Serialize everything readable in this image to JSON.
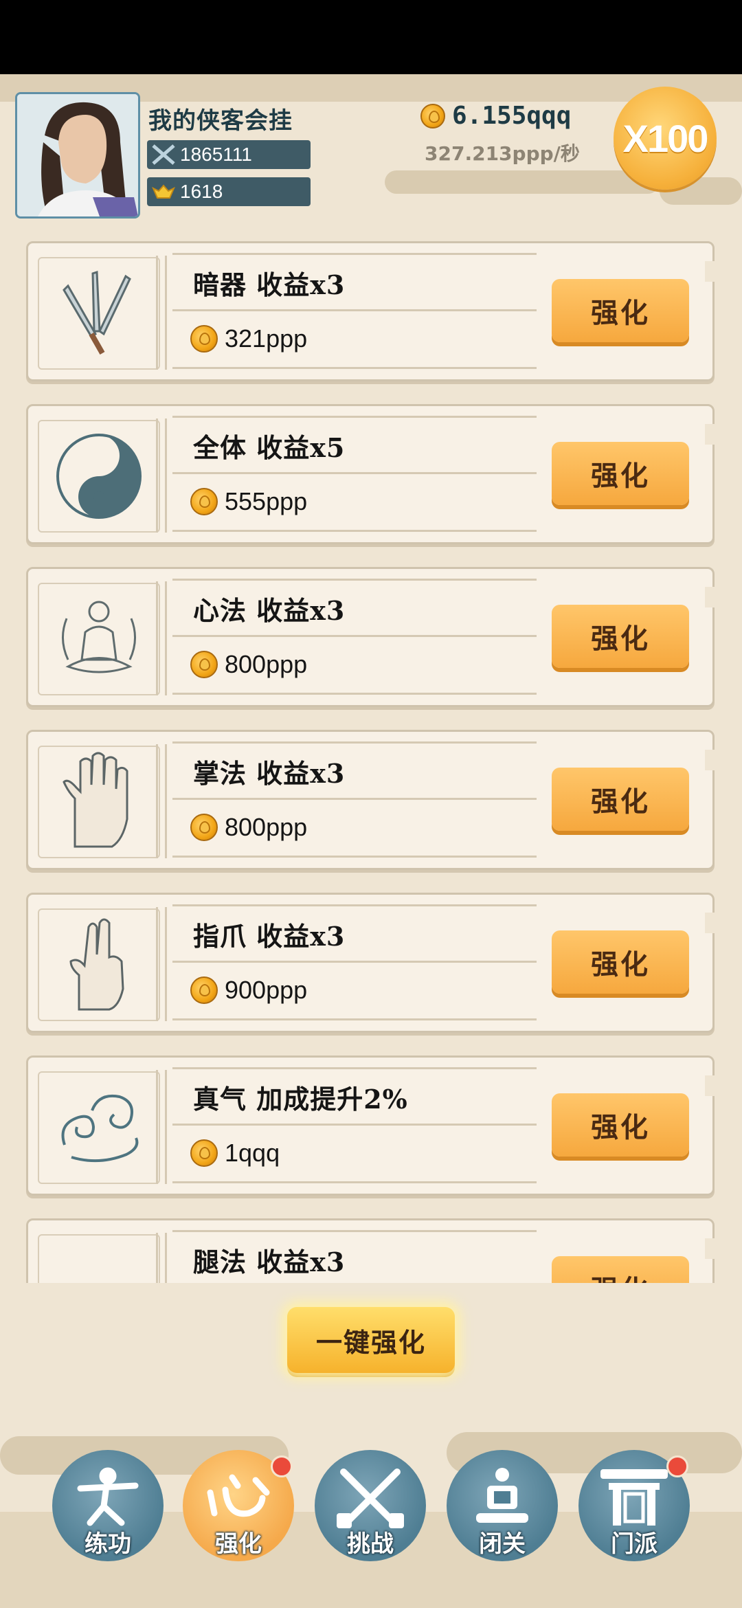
{
  "header": {
    "player_name": "我的侠客会挂",
    "combat_power": "1865111",
    "ingots": "1618",
    "gold_total": "6.155qqq",
    "gold_rate": "327.213ppp/秒",
    "multiplier": "X100"
  },
  "upgrades": [
    {
      "title": "暗器 收益x3",
      "cost": "321ppp",
      "button": "强化",
      "icon": "throwing-knives-icon"
    },
    {
      "title": "全体 收益x5",
      "cost": "555ppp",
      "button": "强化",
      "icon": "yin-yang-icon"
    },
    {
      "title": "心法 收益x3",
      "cost": "800ppp",
      "button": "强化",
      "icon": "meditating-monk-icon"
    },
    {
      "title": "掌法 收益x3",
      "cost": "800ppp",
      "button": "强化",
      "icon": "open-palm-icon"
    },
    {
      "title": "指爪 收益x3",
      "cost": "900ppp",
      "button": "强化",
      "icon": "two-finger-hand-icon"
    },
    {
      "title": "真气 加成提升2%",
      "cost": "1qqq",
      "button": "强化",
      "icon": "swirling-cloud-icon"
    },
    {
      "title": "腿法 收益x3",
      "cost": "",
      "button": "强化",
      "icon": "kick-icon"
    }
  ],
  "one_click_label": "一键强化",
  "nav": [
    {
      "label": "练功",
      "icon": "training-figure-icon",
      "active": false,
      "badge": false
    },
    {
      "label": "强化",
      "icon": "heart-glyph-icon",
      "active": true,
      "badge": true
    },
    {
      "label": "挑战",
      "icon": "crossed-swords-icon",
      "active": false,
      "badge": false
    },
    {
      "label": "闭关",
      "icon": "meditation-seat-icon",
      "active": false,
      "badge": false
    },
    {
      "label": "门派",
      "icon": "sect-gate-icon",
      "active": false,
      "badge": true
    }
  ],
  "colors": {
    "accent_orange": "#f6a83e",
    "panel": "#f8f1e6",
    "navy_pill": "#3f5b66",
    "background": "#efe5d3"
  }
}
